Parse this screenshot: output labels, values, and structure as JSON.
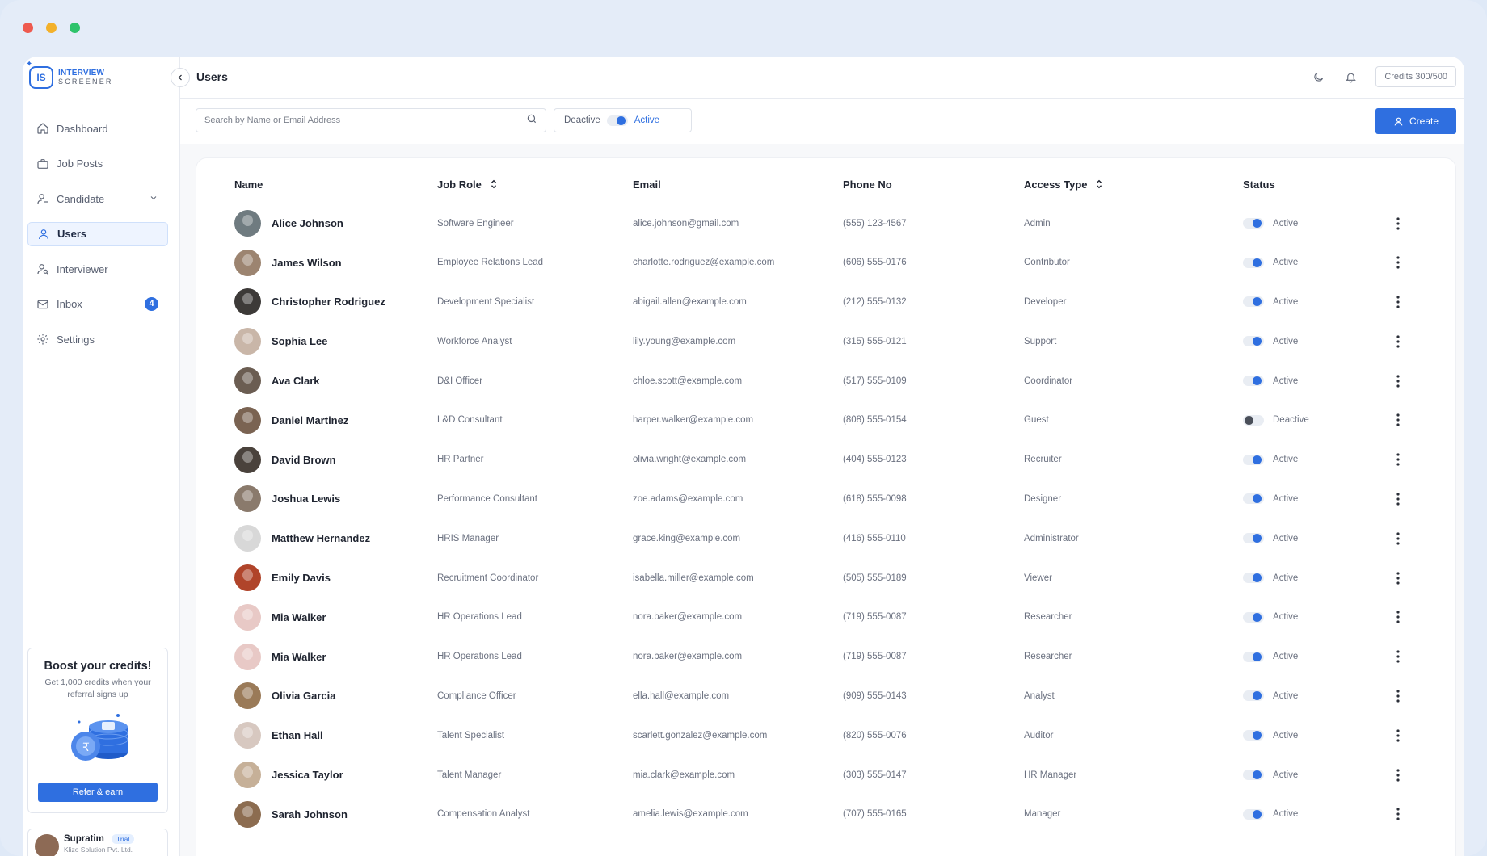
{
  "sidebar": {
    "logo_line1": "INTERVIEW",
    "logo_line2": "SCREENER",
    "logo_mark": "IS",
    "items": [
      {
        "label": "Dashboard",
        "icon": "home-icon"
      },
      {
        "label": "Job Posts",
        "icon": "briefcase-icon"
      },
      {
        "label": "Candidate",
        "icon": "user-check-icon"
      },
      {
        "label": "Users",
        "icon": "user-icon",
        "active": true
      },
      {
        "label": "Interviewer",
        "icon": "user-search-icon"
      },
      {
        "label": "Inbox",
        "icon": "mail-icon",
        "badge": "4"
      },
      {
        "label": "Settings",
        "icon": "gear-icon"
      }
    ],
    "promo": {
      "title": "Boost your credits!",
      "text": "Get 1,000 credits when your referral signs up",
      "button": "Refer & earn"
    },
    "user": {
      "name": "Supratim",
      "plan": "Trial",
      "company": "Klizo Solution Pvt. Ltd."
    }
  },
  "header": {
    "title": "Users",
    "credits": "Credits 300/500"
  },
  "toolbar": {
    "search_placeholder": "Search by Name or Email Address",
    "filter_off": "Deactive",
    "filter_on": "Active",
    "create_label": "Create"
  },
  "table": {
    "columns": [
      "Name",
      "Job Role",
      "Email",
      "Phone No",
      "Access Type",
      "Status"
    ],
    "rows": [
      {
        "name": "Alice Johnson",
        "role": "Software Engineer",
        "email": "alice.johnson@gmail.com",
        "phone": "(555) 123-4567",
        "access": "Admin",
        "status": "Active",
        "avatar": "#6f7b80"
      },
      {
        "name": "James Wilson",
        "role": "Employee Relations Lead",
        "email": "charlotte.rodriguez@example.com",
        "phone": "(606) 555-0176",
        "access": "Contributor",
        "status": "Active",
        "avatar": "#9c8470"
      },
      {
        "name": "Christopher Rodriguez",
        "role": "Development Specialist",
        "email": "abigail.allen@example.com",
        "phone": "(212) 555-0132",
        "access": "Developer",
        "status": "Active",
        "avatar": "#3d3a38"
      },
      {
        "name": "Sophia Lee",
        "role": "Workforce Analyst",
        "email": "lily.young@example.com",
        "phone": "(315) 555-0121",
        "access": "Support",
        "status": "Active",
        "avatar": "#c9b6a8"
      },
      {
        "name": "Ava Clark",
        "role": "D&I Officer",
        "email": "chloe.scott@example.com",
        "phone": "(517) 555-0109",
        "access": "Coordinator",
        "status": "Active",
        "avatar": "#6b5d52"
      },
      {
        "name": "Daniel Martinez",
        "role": "L&D Consultant",
        "email": "harper.walker@example.com",
        "phone": "(808) 555-0154",
        "access": "Guest",
        "status": "Deactive",
        "avatar": "#7a6352"
      },
      {
        "name": "David Brown",
        "role": "HR Partner",
        "email": "olivia.wright@example.com",
        "phone": "(404) 555-0123",
        "access": "Recruiter",
        "status": "Active",
        "avatar": "#4a423c"
      },
      {
        "name": "Joshua Lewis",
        "role": "Performance Consultant",
        "email": "zoe.adams@example.com",
        "phone": "(618) 555-0098",
        "access": "Designer",
        "status": "Active",
        "avatar": "#8a7a6c"
      },
      {
        "name": "Matthew Hernandez",
        "role": "HRIS Manager",
        "email": "grace.king@example.com",
        "phone": "(416) 555-0110",
        "access": "Administrator",
        "status": "Active",
        "avatar": "#d8d8d8"
      },
      {
        "name": "Emily Davis",
        "role": "Recruitment Coordinator",
        "email": "isabella.miller@example.com",
        "phone": "(505) 555-0189",
        "access": "Viewer",
        "status": "Active",
        "avatar": "#b0442a"
      },
      {
        "name": "Mia Walker",
        "role": "HR Operations Lead",
        "email": "nora.baker@example.com",
        "phone": "(719) 555-0087",
        "access": "Researcher",
        "status": "Active",
        "avatar": "#e8c9c6"
      },
      {
        "name": "Mia Walker",
        "role": "HR Operations Lead",
        "email": "nora.baker@example.com",
        "phone": "(719) 555-0087",
        "access": "Researcher",
        "status": "Active",
        "avatar": "#e8c9c6"
      },
      {
        "name": "Olivia Garcia",
        "role": "Compliance Officer",
        "email": "ella.hall@example.com",
        "phone": "(909) 555-0143",
        "access": "Analyst",
        "status": "Active",
        "avatar": "#9a7a58"
      },
      {
        "name": "Ethan Hall",
        "role": "Talent Specialist",
        "email": "scarlett.gonzalez@example.com",
        "phone": "(820) 555-0076",
        "access": "Auditor",
        "status": "Active",
        "avatar": "#d7c8c0"
      },
      {
        "name": "Jessica Taylor",
        "role": "Talent Manager",
        "email": "mia.clark@example.com",
        "phone": "(303) 555-0147",
        "access": "HR Manager",
        "status": "Active",
        "avatar": "#c6b098"
      },
      {
        "name": "Sarah Johnson",
        "role": "Compensation Analyst",
        "email": "amelia.lewis@example.com",
        "phone": "(707) 555-0165",
        "access": "Manager",
        "status": "Active",
        "avatar": "#8c6c50"
      }
    ]
  },
  "colors": {
    "accent": "#2f6fe0",
    "active_text": "#6b7180"
  }
}
